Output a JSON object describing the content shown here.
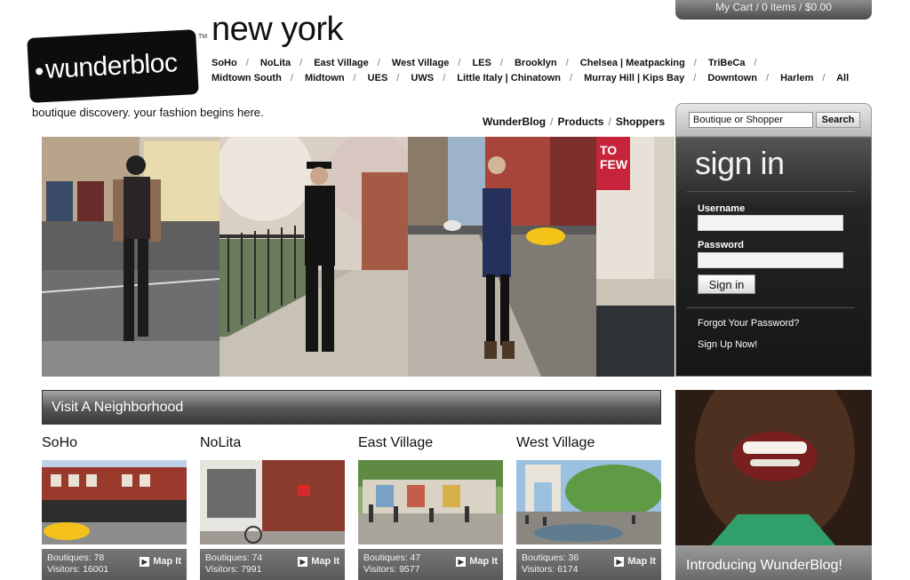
{
  "cart": {
    "label": "My Cart",
    "items": "0 items",
    "total": "$0.00"
  },
  "brand": {
    "logo_text": "wunderbloc",
    "trademark": "TM",
    "city": "new york",
    "tagline": "boutique discovery. your fashion begins here."
  },
  "neighborhood_nav": [
    "SoHo",
    "NoLita",
    "East Village",
    "West Village",
    "LES",
    "Brooklyn",
    "Chelsea | Meatpacking",
    "TriBeCa",
    "Midtown South",
    "Midtown",
    "UES",
    "UWS",
    "Little Italy | Chinatown",
    "Murray Hill | Kips Bay",
    "Downtown",
    "Harlem",
    "All"
  ],
  "subnav": [
    "WunderBlog",
    "Products",
    "Shoppers"
  ],
  "search": {
    "placeholder": "Boutique or Shopper",
    "button": "Search"
  },
  "signin": {
    "title": "sign in",
    "username_label": "Username",
    "password_label": "Password",
    "button": "Sign in",
    "forgot": "Forgot Your Password?",
    "signup": "Sign Up Now!"
  },
  "visit": {
    "title": "Visit A Neighborhood",
    "boutiques_label": "Boutiques:",
    "visitors_label": "Visitors:",
    "map_label": "Map It",
    "neighborhoods": [
      {
        "name": "SoHo",
        "boutiques": "78",
        "visitors": "16001"
      },
      {
        "name": "NoLita",
        "boutiques": "74",
        "visitors": "7991"
      },
      {
        "name": "East Village",
        "boutiques": "47",
        "visitors": "9577"
      },
      {
        "name": "West Village",
        "boutiques": "36",
        "visitors": "6174"
      }
    ]
  },
  "promo": {
    "caption": "Introducing WunderBlog!"
  },
  "colors": {
    "dark_panel": "#161616",
    "bar_gray": "#555555",
    "text": "#111111"
  }
}
